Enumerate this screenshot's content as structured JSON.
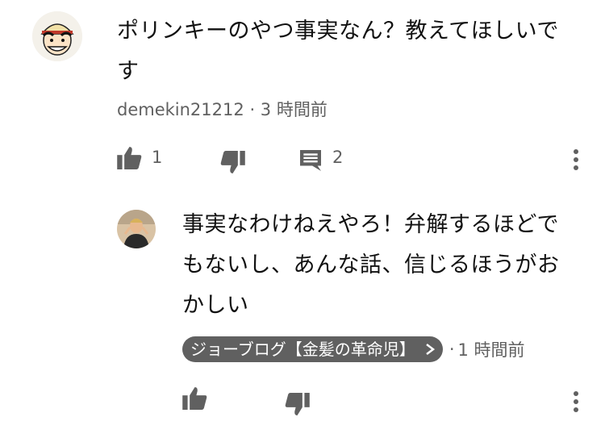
{
  "comment": {
    "text_line1": "ポリンキーのやつ事実なん？教えてほしいで",
    "text_line2": "す",
    "author": "demekin21212",
    "time": "3 時間前",
    "like_count": "1",
    "reply_count": "2",
    "icons": [
      "thumb-up-icon",
      "thumb-down-icon",
      "comment-icon",
      "more-vert-icon"
    ]
  },
  "reply": {
    "text_line1": "事実なわけねえやろ！弁解するほどで",
    "text_line2": "もないし、あんな話、信じるほうがお",
    "text_line3": "かしい",
    "author": "ジョーブログ【金髪の革命児】",
    "time": "1 時間前",
    "icons": [
      "thumb-up-icon",
      "thumb-down-icon",
      "more-vert-icon"
    ]
  },
  "colors": {
    "meta_gray": "#606060",
    "badge_bg": "#606060"
  }
}
